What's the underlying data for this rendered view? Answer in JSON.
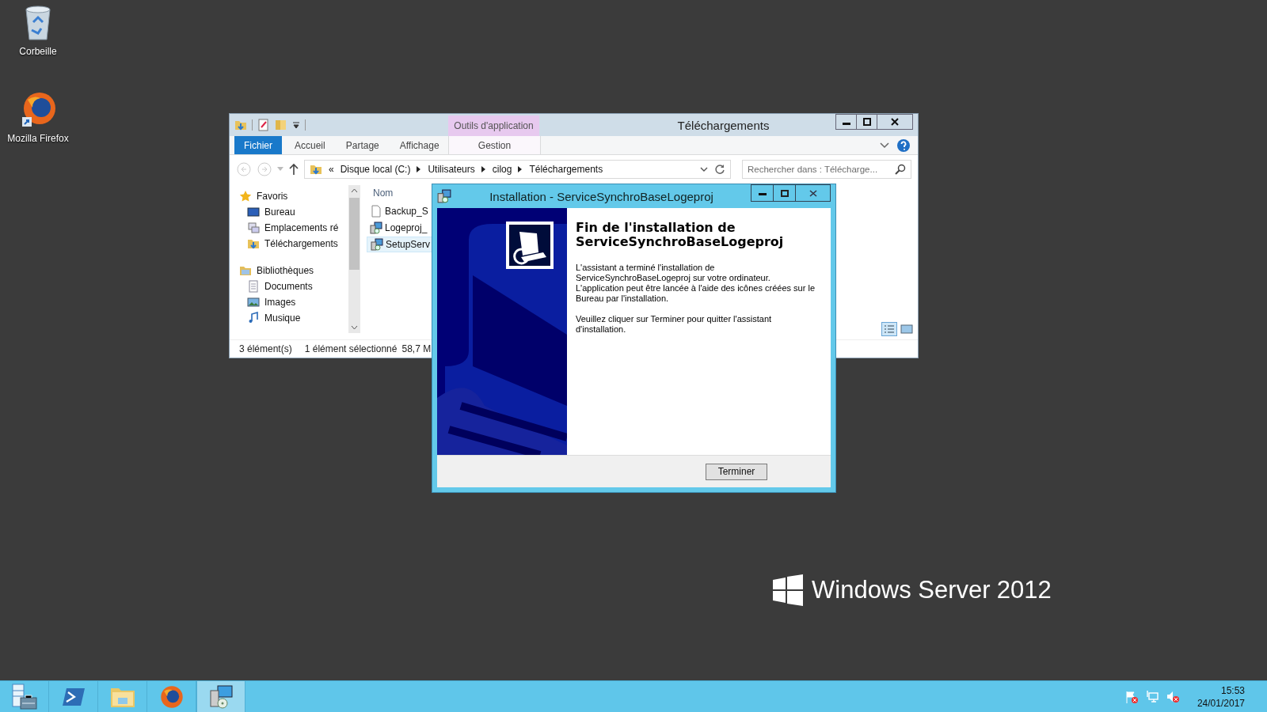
{
  "desktop_icons": [
    {
      "label": "Corbeille",
      "kind": "recycle-bin"
    },
    {
      "label": "Mozilla Firefox",
      "kind": "firefox"
    }
  ],
  "branding": {
    "name": "Windows Server",
    "version": "2012"
  },
  "explorer": {
    "title": "Téléchargements",
    "contextual_group": "Outils d'application",
    "ribbon_tabs": [
      {
        "label": "Fichier",
        "kind": "file"
      },
      {
        "label": "Accueil",
        "kind": "tab"
      },
      {
        "label": "Partage",
        "kind": "tab"
      },
      {
        "label": "Affichage",
        "kind": "tab"
      },
      {
        "label": "Gestion",
        "kind": "contextual"
      }
    ],
    "address": {
      "overflow": "«",
      "crumbs": [
        "Disque local (C:)",
        "Utilisateurs",
        "cilog",
        "Téléchargements"
      ]
    },
    "search": {
      "placeholder": "Rechercher dans : Télécharge..."
    },
    "nav": [
      {
        "label": "Favoris",
        "kind": "star",
        "children": [
          {
            "label": "Bureau",
            "kind": "desktop"
          },
          {
            "label": "Emplacements ré",
            "kind": "places"
          },
          {
            "label": "Téléchargements",
            "kind": "downloads"
          }
        ]
      },
      {
        "label": "Bibliothèques",
        "kind": "libraries",
        "children": [
          {
            "label": "Documents",
            "kind": "documents"
          },
          {
            "label": "Images",
            "kind": "images"
          },
          {
            "label": "Musique",
            "kind": "music"
          }
        ]
      }
    ],
    "column": "Nom",
    "files": [
      {
        "name": "Backup_S",
        "kind": "file",
        "selected": false
      },
      {
        "name": "Logeproj_",
        "kind": "installer",
        "selected": false
      },
      {
        "name": "SetupServ",
        "kind": "installer",
        "selected": true
      }
    ],
    "status": [
      "3 élément(s)",
      "1 élément sélectionné",
      "58,7 M"
    ]
  },
  "dialog": {
    "title": "Installation - ServiceSynchroBaseLogeproj",
    "heading": "Fin de l'installation de ServiceSynchroBaseLogeproj",
    "paragraphs": [
      [
        "L'assistant a terminé l'installation de ServiceSynchroBaseLogeproj sur votre ordinateur.",
        "L'application peut être lancée à l'aide des icônes créées sur le Bureau par l'installation."
      ],
      [
        "Veuillez cliquer sur Terminer pour quitter l'assistant d'installation."
      ]
    ],
    "button": "Terminer"
  },
  "taskbar": {
    "apps": [
      {
        "kind": "server-manager",
        "selected": false
      },
      {
        "kind": "powershell",
        "selected": false
      },
      {
        "kind": "explorer",
        "selected": false
      },
      {
        "kind": "firefox",
        "selected": false
      },
      {
        "kind": "installer",
        "selected": true
      }
    ],
    "time": "15:53",
    "date": "24/01/2017"
  }
}
